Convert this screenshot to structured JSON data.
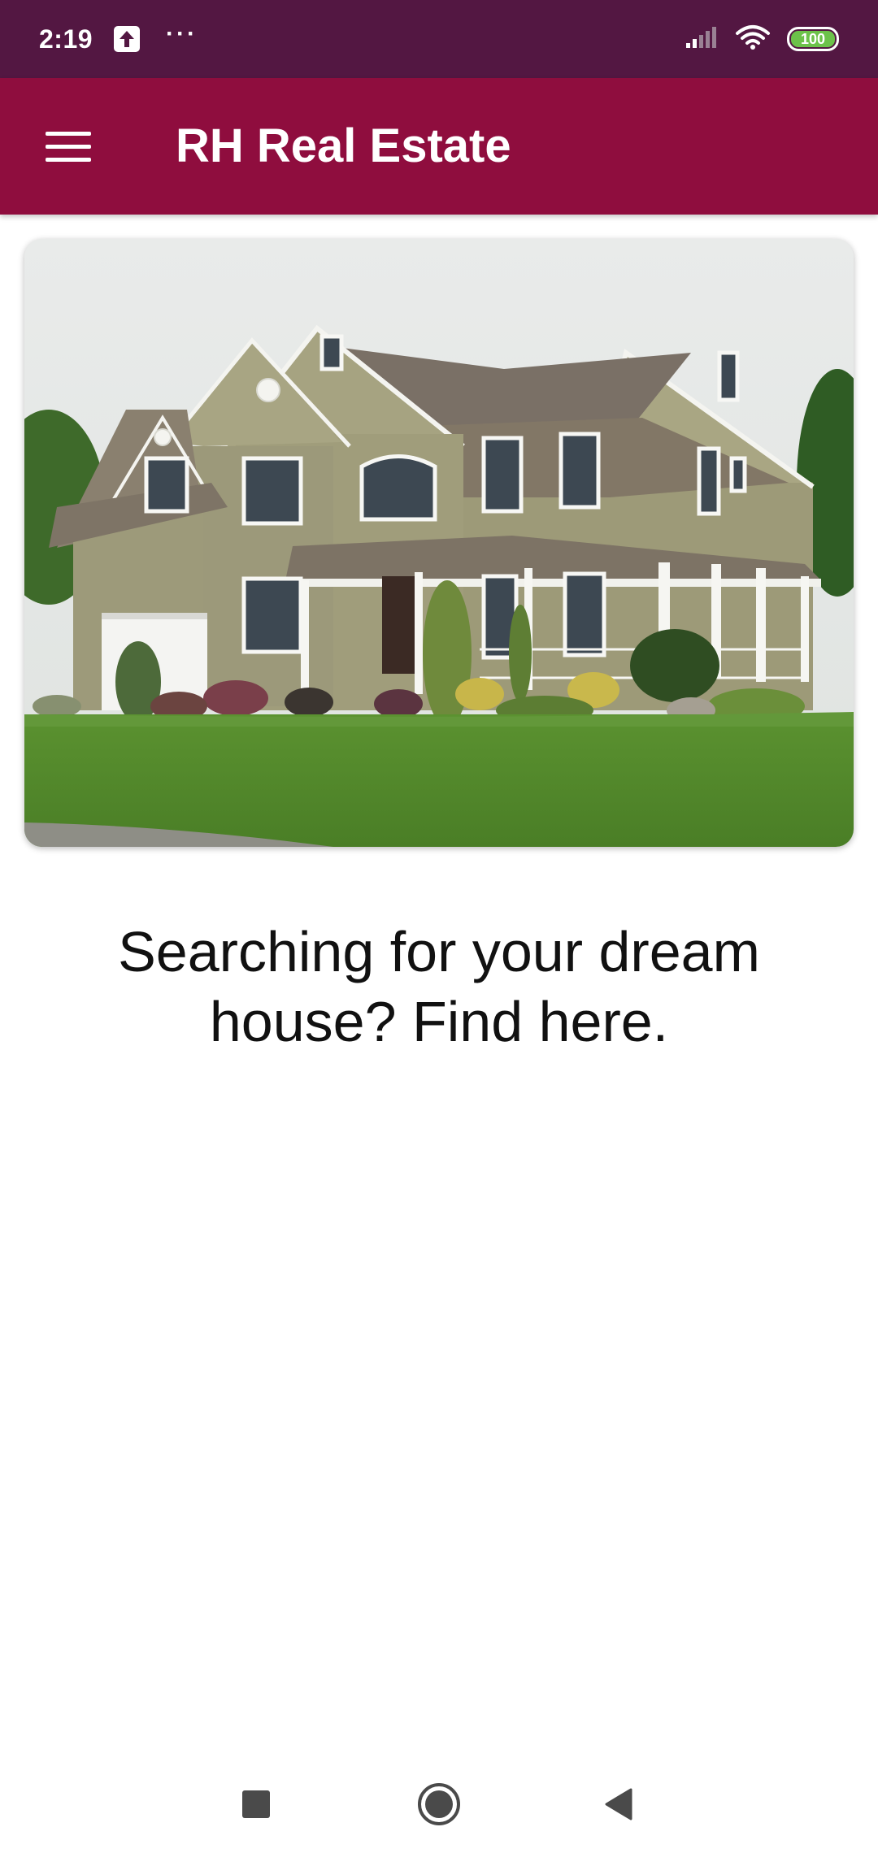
{
  "status_bar": {
    "time": "2:19",
    "dots": "···",
    "battery_level": "100",
    "icons": [
      "upload-icon",
      "signal-icon",
      "wifi-icon",
      "battery-icon"
    ]
  },
  "app_bar": {
    "title": "RH Real Estate",
    "menu_icon": "hamburger-menu-icon"
  },
  "hero": {
    "tagline": "Searching for your dream house? Find here."
  },
  "nav_bar": {
    "icons": [
      "recents-square-icon",
      "home-circle-icon",
      "back-triangle-icon"
    ]
  },
  "colors": {
    "status_bar": "#531742",
    "app_bar": "#8f0d3e",
    "battery_fill": "#6cc24a",
    "background": "#ffffff"
  }
}
